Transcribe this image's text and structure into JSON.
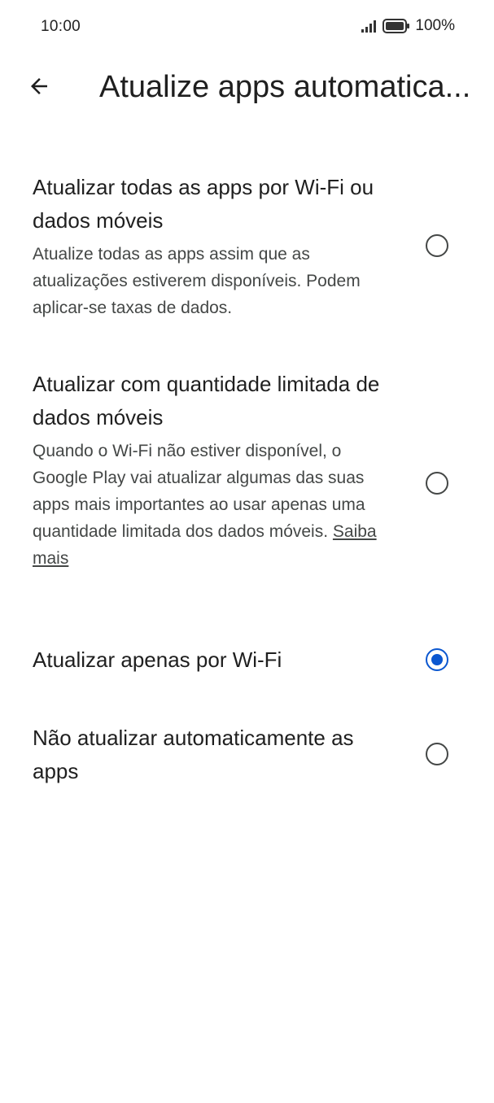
{
  "status_bar": {
    "time": "10:00",
    "battery_percent": "100%",
    "icons": [
      "signal-icon",
      "battery-icon"
    ]
  },
  "app_bar": {
    "back_icon": "arrow-back-icon",
    "title": "Atualize apps automatica..."
  },
  "options": [
    {
      "title": "Atualizar todas as apps por Wi-Fi ou dados móveis",
      "description": "Atualize todas as apps assim que as atualizações estiverem disponíveis. Podem aplicar-se taxas de dados.",
      "selected": false
    },
    {
      "title": "Atualizar com quantidade limitada de dados móveis",
      "description": "Quando o Wi-Fi não estiver disponível, o Google Play vai atualizar algumas das suas apps mais importantes ao usar apenas uma quantidade limitada dos dados móveis.",
      "link": "Saiba mais",
      "selected": false
    },
    {
      "title": "Atualizar apenas por Wi-Fi",
      "selected": true
    },
    {
      "title": "Não atualizar automaticamente as apps",
      "selected": false
    }
  ],
  "colors": {
    "accent": "#0b57d0",
    "text_primary": "#1f1f1f",
    "text_secondary": "#444746",
    "background": "#ffffff"
  }
}
